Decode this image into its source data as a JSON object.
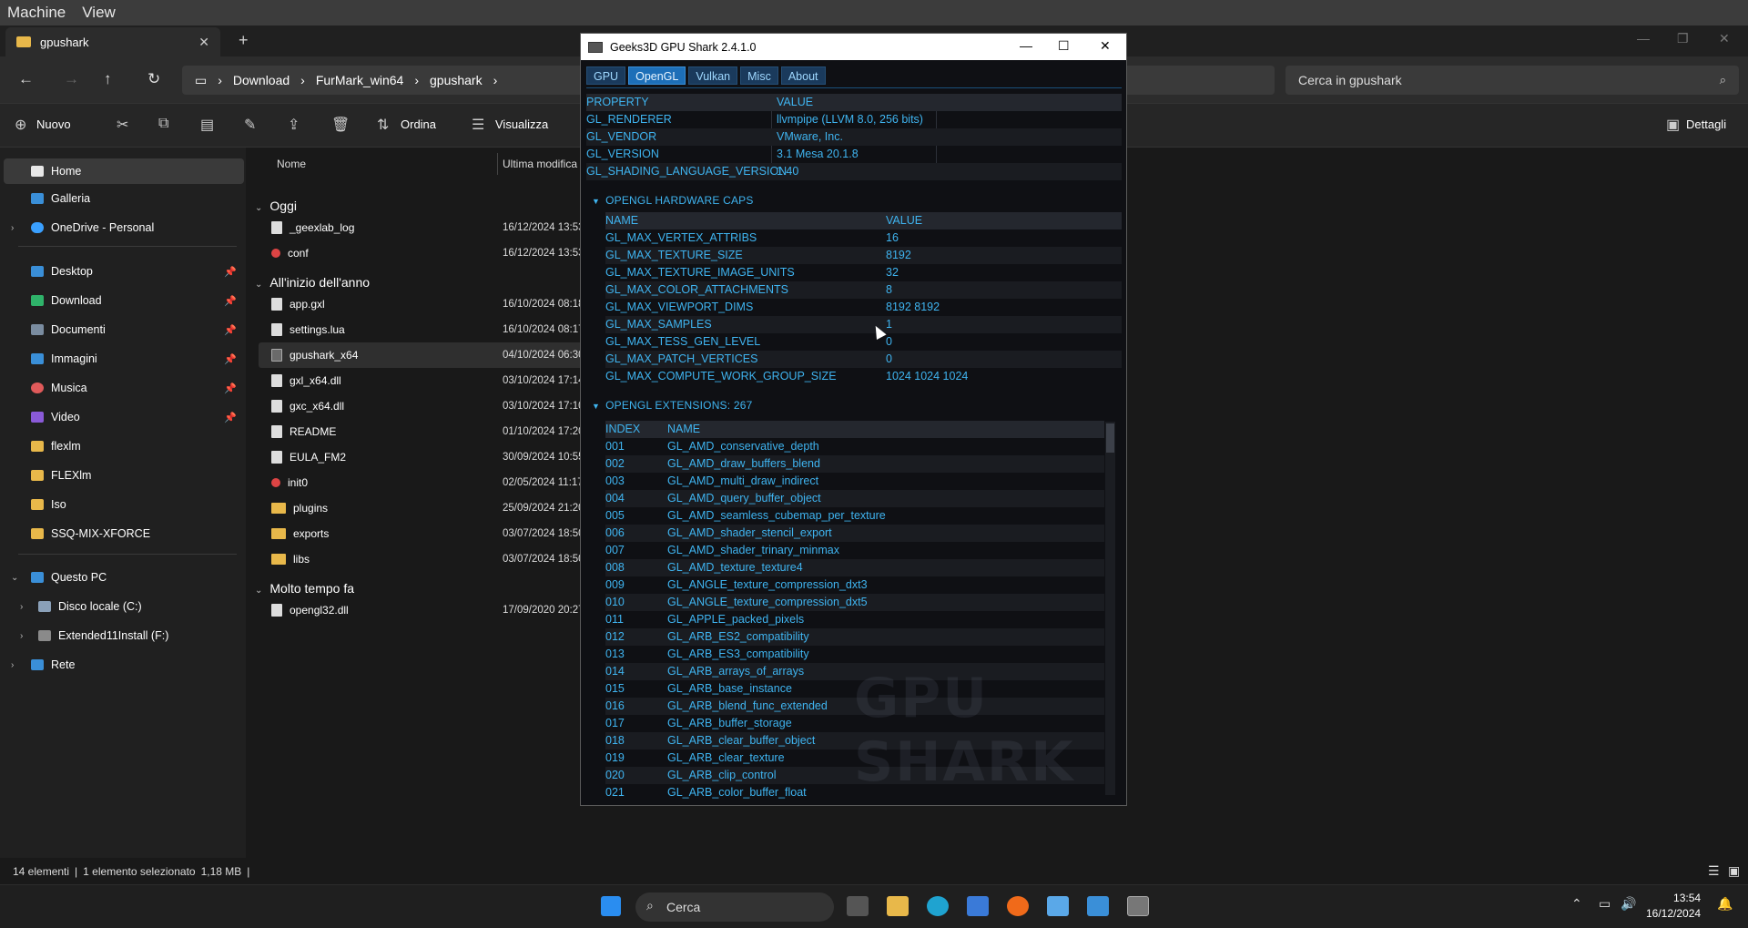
{
  "vm_menu": [
    "Machine",
    "View"
  ],
  "explorer": {
    "tab_title": "gpushark",
    "breadcrumb": [
      "Download",
      "FurMark_win64",
      "gpushark"
    ],
    "search_placeholder": "Cerca in gpushark",
    "toolbar": {
      "new": "Nuovo",
      "sort": "Ordina",
      "view": "Visualizza",
      "details": "Dettagli"
    },
    "nav": [
      {
        "label": "Home"
      },
      {
        "label": "Galleria"
      },
      {
        "label": "OneDrive - Personal"
      },
      {
        "label": "Desktop"
      },
      {
        "label": "Download"
      },
      {
        "label": "Documenti"
      },
      {
        "label": "Immagini"
      },
      {
        "label": "Musica"
      },
      {
        "label": "Video"
      },
      {
        "label": "flexlm"
      },
      {
        "label": "FLEXlm"
      },
      {
        "label": "Iso"
      },
      {
        "label": "SSQ-MIX-XFORCE"
      },
      {
        "label": "Questo PC"
      },
      {
        "label": "Disco locale (C:)"
      },
      {
        "label": "Extended11Install (F:)"
      },
      {
        "label": "Rete"
      }
    ],
    "columns": {
      "name": "Nome",
      "modified": "Ultima modifica"
    },
    "groups": [
      {
        "label": "Oggi",
        "files": [
          {
            "name": "_geexlab_log",
            "date": "16/12/2024 13:53"
          },
          {
            "name": "conf",
            "date": "16/12/2024 13:53"
          }
        ]
      },
      {
        "label": "All'inizio dell'anno",
        "files": [
          {
            "name": "app.gxl",
            "date": "16/10/2024 08:18"
          },
          {
            "name": "settings.lua",
            "date": "16/10/2024 08:17"
          },
          {
            "name": "gpushark_x64",
            "date": "04/10/2024 06:30"
          },
          {
            "name": "gxl_x64.dll",
            "date": "03/10/2024 17:14"
          },
          {
            "name": "gxc_x64.dll",
            "date": "03/10/2024 17:10"
          },
          {
            "name": "README",
            "date": "01/10/2024 17:20"
          },
          {
            "name": "EULA_FM2",
            "date": "30/09/2024 10:55"
          },
          {
            "name": "init0",
            "date": "02/05/2024 11:17"
          },
          {
            "name": "plugins",
            "date": "25/09/2024 21:20"
          },
          {
            "name": "exports",
            "date": "03/07/2024 18:50"
          },
          {
            "name": "libs",
            "date": "03/07/2024 18:50"
          }
        ]
      },
      {
        "label": "Molto tempo fa",
        "files": [
          {
            "name": "opengl32.dll",
            "date": "17/09/2020 20:27"
          }
        ]
      }
    ],
    "status": {
      "count": "14 elementi",
      "selected": "1 elemento selezionato",
      "size": "1,18 MB"
    }
  },
  "gpushark": {
    "title": "Geeks3D GPU Shark 2.4.1.0",
    "tabs": [
      "GPU",
      "OpenGL",
      "Vulkan",
      "Misc",
      "About"
    ],
    "active_tab": "OpenGL",
    "props_header": {
      "property": "PROPERTY",
      "value": "VALUE"
    },
    "props": [
      {
        "property": "GL_RENDERER",
        "value": "llvmpipe (LLVM 8.0, 256 bits)"
      },
      {
        "property": "GL_VENDOR",
        "value": "VMware, Inc."
      },
      {
        "property": "GL_VERSION",
        "value": "3.1 Mesa 20.1.8"
      },
      {
        "property": "GL_SHADING_LANGUAGE_VERSION",
        "value": "1.40"
      }
    ],
    "caps_title": "OPENGL HARDWARE CAPS",
    "caps_header": {
      "name": "NAME",
      "value": "VALUE"
    },
    "caps": [
      {
        "name": "GL_MAX_VERTEX_ATTRIBS",
        "value": "16"
      },
      {
        "name": "GL_MAX_TEXTURE_SIZE",
        "value": "8192"
      },
      {
        "name": "GL_MAX_TEXTURE_IMAGE_UNITS",
        "value": "32"
      },
      {
        "name": "GL_MAX_COLOR_ATTACHMENTS",
        "value": "8"
      },
      {
        "name": "GL_MAX_VIEWPORT_DIMS",
        "value": "8192 8192"
      },
      {
        "name": "GL_MAX_SAMPLES",
        "value": "1"
      },
      {
        "name": "GL_MAX_TESS_GEN_LEVEL",
        "value": "0"
      },
      {
        "name": "GL_MAX_PATCH_VERTICES",
        "value": "0"
      },
      {
        "name": "GL_MAX_COMPUTE_WORK_GROUP_SIZE",
        "value": "1024 1024 1024"
      }
    ],
    "ext_title": "OPENGL EXTENSIONS: 267",
    "ext_header": {
      "index": "INDEX",
      "name": "NAME"
    },
    "extensions": [
      {
        "index": "001",
        "name": "GL_AMD_conservative_depth"
      },
      {
        "index": "002",
        "name": "GL_AMD_draw_buffers_blend"
      },
      {
        "index": "003",
        "name": "GL_AMD_multi_draw_indirect"
      },
      {
        "index": "004",
        "name": "GL_AMD_query_buffer_object"
      },
      {
        "index": "005",
        "name": "GL_AMD_seamless_cubemap_per_texture"
      },
      {
        "index": "006",
        "name": "GL_AMD_shader_stencil_export"
      },
      {
        "index": "007",
        "name": "GL_AMD_shader_trinary_minmax"
      },
      {
        "index": "008",
        "name": "GL_AMD_texture_texture4"
      },
      {
        "index": "009",
        "name": "GL_ANGLE_texture_compression_dxt3"
      },
      {
        "index": "010",
        "name": "GL_ANGLE_texture_compression_dxt5"
      },
      {
        "index": "011",
        "name": "GL_APPLE_packed_pixels"
      },
      {
        "index": "012",
        "name": "GL_ARB_ES2_compatibility"
      },
      {
        "index": "013",
        "name": "GL_ARB_ES3_compatibility"
      },
      {
        "index": "014",
        "name": "GL_ARB_arrays_of_arrays"
      },
      {
        "index": "015",
        "name": "GL_ARB_base_instance"
      },
      {
        "index": "016",
        "name": "GL_ARB_blend_func_extended"
      },
      {
        "index": "017",
        "name": "GL_ARB_buffer_storage"
      },
      {
        "index": "018",
        "name": "GL_ARB_clear_buffer_object"
      },
      {
        "index": "019",
        "name": "GL_ARB_clear_texture"
      },
      {
        "index": "020",
        "name": "GL_ARB_clip_control"
      },
      {
        "index": "021",
        "name": "GL_ARB_color_buffer_float"
      }
    ],
    "watermark": "GPU SHARK"
  },
  "taskbar": {
    "search": "Cerca",
    "time": "13:54",
    "date": "16/12/2024"
  }
}
